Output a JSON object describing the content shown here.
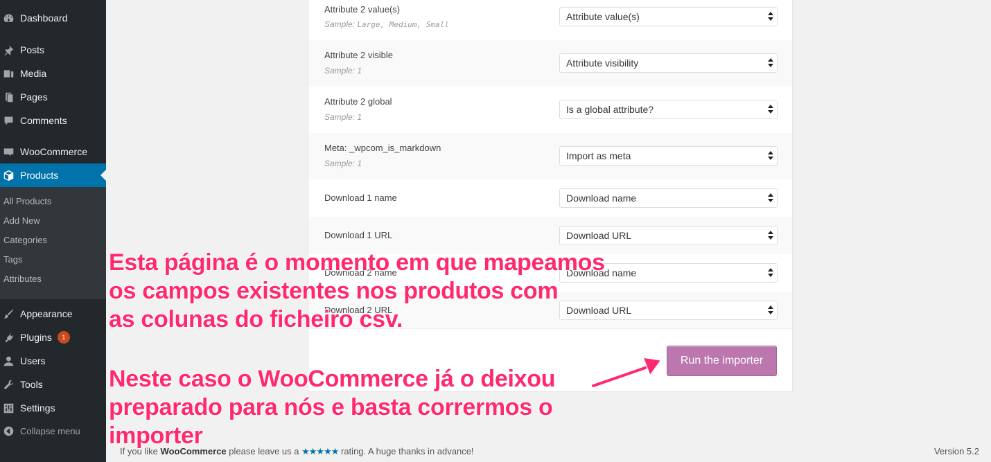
{
  "sidebar": {
    "menu": [
      {
        "label": "Dashboard",
        "icon": "dashboard-icon"
      },
      {
        "label": "Posts",
        "icon": "pin-icon"
      },
      {
        "label": "Media",
        "icon": "media-icon"
      },
      {
        "label": "Pages",
        "icon": "pages-icon"
      },
      {
        "label": "Comments",
        "icon": "comment-icon"
      },
      {
        "label": "WooCommerce",
        "icon": "woo-icon"
      },
      {
        "label": "Products",
        "icon": "box-icon"
      },
      {
        "label": "Appearance",
        "icon": "brush-icon"
      },
      {
        "label": "Plugins",
        "icon": "plug-icon",
        "badge": "1"
      },
      {
        "label": "Users",
        "icon": "user-icon"
      },
      {
        "label": "Tools",
        "icon": "wrench-icon"
      },
      {
        "label": "Settings",
        "icon": "settings-icon"
      },
      {
        "label": "Collapse menu",
        "icon": "collapse-icon"
      }
    ],
    "submenu": [
      "All Products",
      "Add New",
      "Categories",
      "Tags",
      "Attributes"
    ]
  },
  "mapping": {
    "rows": [
      {
        "label": "Attribute 2 value(s)",
        "sample_prefix": "Sample:",
        "sample_value": "Large, Medium, Small",
        "select": "Attribute value(s)"
      },
      {
        "label": "Attribute 2 visible",
        "sample_prefix": "Sample:",
        "sample_value": "1",
        "select": "Attribute visibility"
      },
      {
        "label": "Attribute 2 global",
        "sample_prefix": "Sample:",
        "sample_value": "1",
        "select": "Is a global attribute?"
      },
      {
        "label": "Meta: _wpcom_is_markdown",
        "sample_prefix": "Sample:",
        "sample_value": "1",
        "select": "Import as meta"
      },
      {
        "label": "Download 1 name",
        "select": "Download name"
      },
      {
        "label": "Download 1 URL",
        "select": "Download URL"
      },
      {
        "label": "Download 2 name",
        "select": "Download name"
      },
      {
        "label": "Download 2 URL",
        "select": "Download URL"
      }
    ],
    "run_button": "Run the importer"
  },
  "footer": {
    "text_before": "If you like",
    "brand": "WooCommerce",
    "text_mid": "please leave us a",
    "stars": "★★★★★",
    "text_after": "rating. A huge thanks in advance!",
    "version": "Version 5.2"
  },
  "annotation": {
    "lines": [
      "Esta página é o momento em que mapeamos",
      "os campos existentes nos produtos com",
      "as colunas do ficheiro csv.",
      "Neste caso o WooCommerce já o deixou",
      "preparado para nós e basta corrermos o",
      "importer"
    ],
    "color": "#ff2a6d"
  }
}
